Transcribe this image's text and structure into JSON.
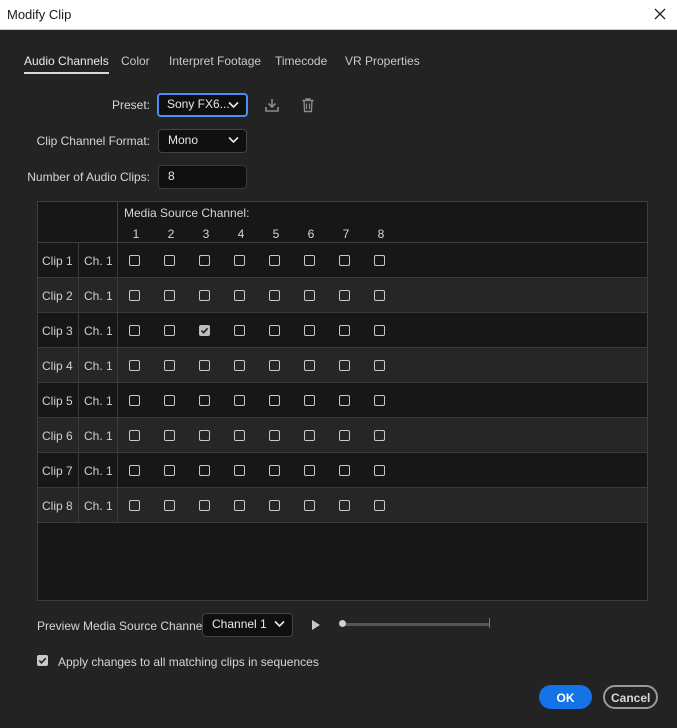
{
  "window": {
    "title": "Modify Clip"
  },
  "tabs": [
    "Audio Channels",
    "Color",
    "Interpret Footage",
    "Timecode",
    "VR Properties"
  ],
  "active_tab": "Audio Channels",
  "preset": {
    "label": "Preset:",
    "value": "Sony FX6..."
  },
  "clip_channel_format": {
    "label": "Clip Channel Format:",
    "value": "Mono"
  },
  "num_audio_clips": {
    "label": "Number of Audio Clips:",
    "value": "8"
  },
  "grid": {
    "header_label": "Media Source Channel:",
    "channels": [
      "1",
      "2",
      "3",
      "4",
      "5",
      "6",
      "7",
      "8"
    ],
    "rows": [
      {
        "clip": "Clip 1",
        "ch": "Ch. 1",
        "checked": []
      },
      {
        "clip": "Clip 2",
        "ch": "Ch. 1",
        "checked": []
      },
      {
        "clip": "Clip 3",
        "ch": "Ch. 1",
        "checked": [
          3
        ]
      },
      {
        "clip": "Clip 4",
        "ch": "Ch. 1",
        "checked": []
      },
      {
        "clip": "Clip 5",
        "ch": "Ch. 1",
        "checked": []
      },
      {
        "clip": "Clip 6",
        "ch": "Ch. 1",
        "checked": []
      },
      {
        "clip": "Clip 7",
        "ch": "Ch. 1",
        "checked": []
      },
      {
        "clip": "Clip 8",
        "ch": "Ch. 1",
        "checked": []
      }
    ]
  },
  "preview": {
    "label": "Preview Media Source Channel:",
    "value": "Channel 1",
    "progress": 0
  },
  "apply_all": {
    "label": "Apply changes to all matching clips in sequences",
    "checked": true
  },
  "buttons": {
    "ok": "OK",
    "cancel": "Cancel"
  },
  "colors": {
    "accent": "#1473e6",
    "focus": "#4d8ff0",
    "background": "#232323"
  },
  "icons": [
    "close-icon",
    "chevron-down-icon",
    "download-icon",
    "trash-icon",
    "play-icon",
    "checkmark-icon"
  ]
}
